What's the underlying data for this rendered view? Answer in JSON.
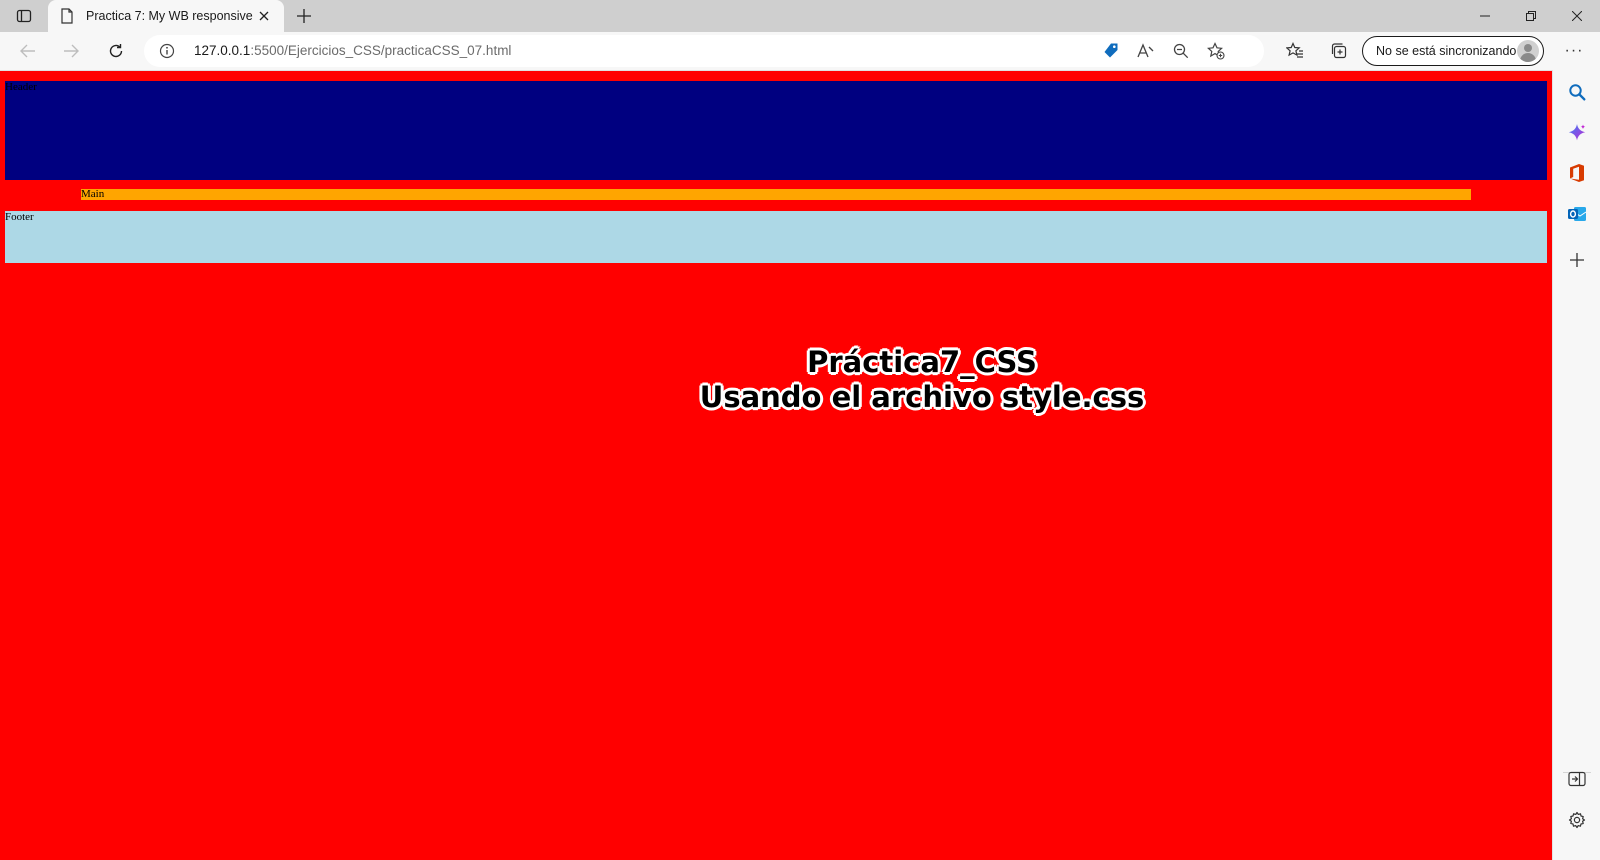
{
  "browser": {
    "tab": {
      "title": "Practica 7: My WB responsive"
    },
    "address_bar": {
      "host": "127.0.0.1",
      "rest": ":5500/Ejercicios_CSS/practicaCSS_07.html"
    },
    "profile": {
      "label": "No se está sincronizando"
    },
    "more_label": "···"
  },
  "page": {
    "background_color": "#ff0000",
    "header": {
      "label": "Header",
      "color": "#000080"
    },
    "main": {
      "label": "Main",
      "color": "#ffa500"
    },
    "footer": {
      "label": "Footer",
      "color": "#add8e6"
    },
    "title": {
      "line1": "Práctica7_CSS",
      "line2": "Usando el archivo style.css"
    }
  },
  "sidebar": {
    "items": [
      "search-icon",
      "copilot-icon",
      "office-icon",
      "outlook-icon",
      "add-icon"
    ],
    "bottom": [
      "split-screen-icon",
      "settings-icon"
    ]
  }
}
